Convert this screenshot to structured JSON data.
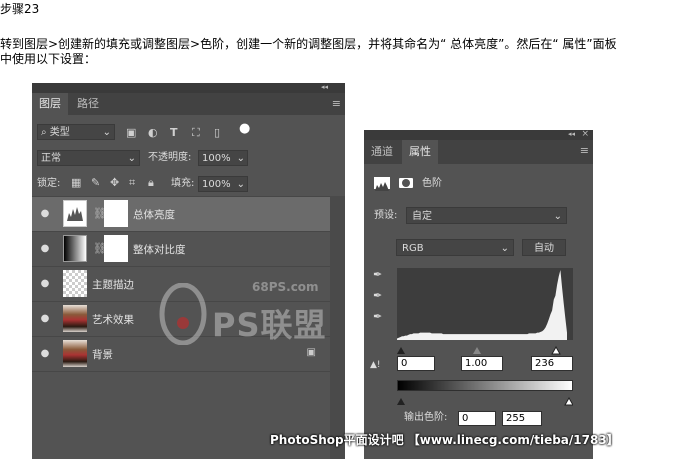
{
  "doc": {
    "step_title": "步骤23",
    "instruction_line1": "转到图层>创建新的填充或调整图层>色阶，创建一个新的调整图层，并将其命名为“ 总体亮度”。然后在“ 属性”面板",
    "instruction_line2": "中使用以下设置："
  },
  "layers_panel": {
    "collapse_glyph": "◂◂",
    "close_glyph": "×",
    "tabs": [
      {
        "label": "图层"
      },
      {
        "label": "路径"
      }
    ],
    "menu_glyph": "≡",
    "filter": {
      "value": "类型"
    },
    "blend_mode": "正常",
    "opacity_label": "不透明度:",
    "opacity_value": "100%",
    "lock_label": "锁定:",
    "fill_label": "填充:",
    "fill_value": "100%",
    "layers": [
      {
        "name": "总体亮度",
        "selected": true,
        "thumb": "levels-icon",
        "has_mask": true
      },
      {
        "name": "整体对比度",
        "selected": false,
        "thumb": "gradient-map-icon",
        "has_mask": true
      },
      {
        "name": "主题描边",
        "selected": false,
        "thumb": "transparent",
        "has_mask": false
      },
      {
        "name": "艺术效果",
        "selected": false,
        "thumb": "photo",
        "has_mask": false
      },
      {
        "name": "背景",
        "selected": false,
        "thumb": "photo",
        "has_mask": false,
        "locked": true
      }
    ]
  },
  "properties_panel": {
    "collapse_glyph": "◂◂",
    "close_glyph": "×",
    "tabs": [
      {
        "label": "通道"
      },
      {
        "label": "属性"
      }
    ],
    "menu_glyph": "≡",
    "title": "色阶",
    "preset_label": "预设:",
    "preset_value": "自定",
    "channel_value": "RGB",
    "auto_button": "自动",
    "input_black": "0",
    "input_gamma": "1.00",
    "input_white": "236",
    "output_label": "输出色阶:",
    "output_black": "0",
    "output_white": "255",
    "histogram": [
      2,
      3,
      4,
      5,
      5,
      6,
      6,
      7,
      8,
      8,
      9,
      9,
      9,
      9,
      10,
      10,
      10,
      10,
      10,
      10,
      10,
      9,
      9,
      9,
      9,
      9,
      9,
      9,
      8,
      8,
      8,
      8,
      8,
      8,
      8,
      8,
      8,
      8,
      8,
      8,
      8,
      8,
      8,
      8,
      8,
      8,
      8,
      8,
      8,
      8,
      8,
      8,
      8,
      8,
      8,
      8,
      8,
      8,
      8,
      8,
      8,
      8,
      8,
      8,
      8,
      8,
      8,
      8,
      8,
      8,
      8,
      8,
      8,
      8,
      8,
      8,
      8,
      8,
      8,
      8,
      9,
      9,
      9,
      9,
      9,
      10,
      10,
      11,
      12,
      14,
      17,
      22,
      28,
      35,
      40,
      55,
      60,
      75,
      86,
      95,
      72,
      50,
      30,
      10
    ]
  },
  "watermark": {
    "site": "68PS.com",
    "logo_text": "PS联盟"
  },
  "footer": {
    "text": "PhotoShop平面设计吧 【www.linecg.com/tieba/1783】"
  },
  "colors": {
    "panel_bg": "#535353",
    "panel_dark": "#424242",
    "selected_row": "#6b6b6b"
  }
}
